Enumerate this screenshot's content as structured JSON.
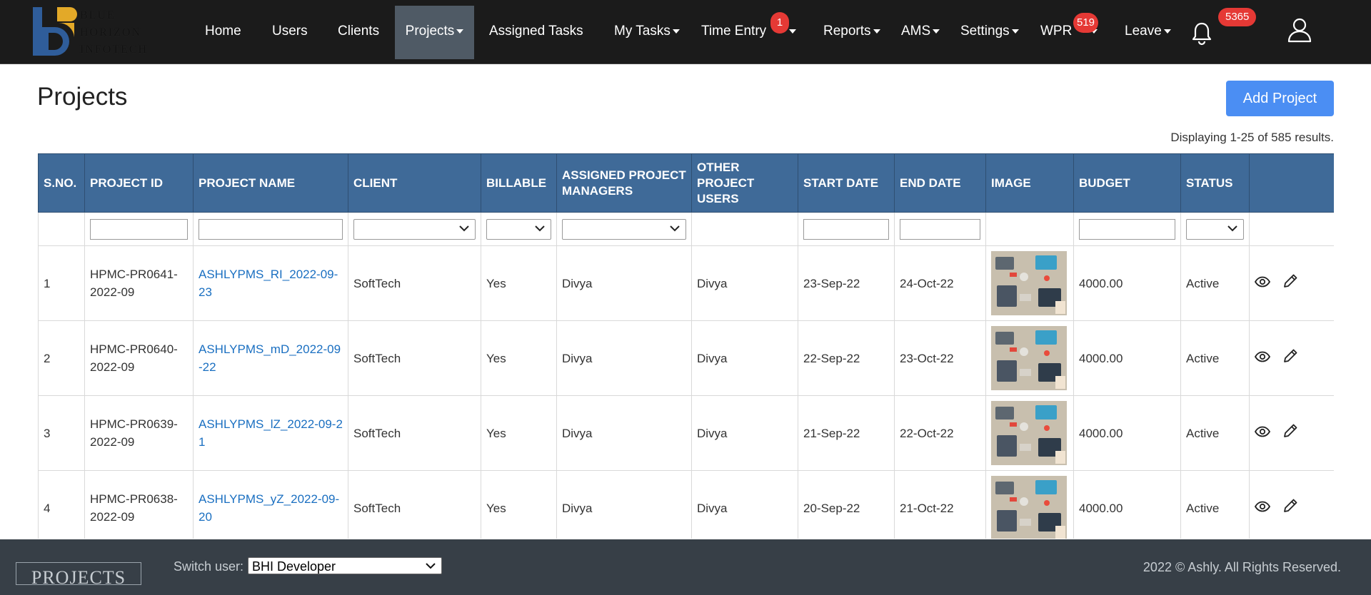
{
  "brand": {
    "name_lines": [
      "BLUE",
      "HORIZON",
      "INFOTECH"
    ]
  },
  "nav": {
    "items": [
      {
        "label": "Home",
        "dropdown": false
      },
      {
        "label": "Users",
        "dropdown": false
      },
      {
        "label": "Clients",
        "dropdown": false
      },
      {
        "label": "Projects",
        "dropdown": true,
        "active": true
      },
      {
        "label": "Assigned Tasks",
        "dropdown": false
      },
      {
        "label": "My Tasks",
        "dropdown": true
      },
      {
        "label": "Time Entry",
        "dropdown": true,
        "badge": "1"
      },
      {
        "label": "Reports",
        "dropdown": true
      },
      {
        "label": "AMS",
        "dropdown": true
      },
      {
        "label": "Settings",
        "dropdown": true
      },
      {
        "label": "WPR",
        "dropdown": true,
        "badge": "519"
      },
      {
        "label": "Leave",
        "dropdown": true
      }
    ],
    "notifications_badge": "5365",
    "icons": [
      "bell-icon",
      "user-icon"
    ]
  },
  "page": {
    "title": "Projects",
    "add_button": "Add Project",
    "summary": "Displaying 1-25 of 585 results."
  },
  "table": {
    "columns": [
      "S.NO.",
      "PROJECT ID",
      "PROJECT NAME",
      "CLIENT",
      "BILLABLE",
      "ASSIGNED PROJECT MANAGERS",
      "OTHER PROJECT USERS",
      "START DATE",
      "END DATE",
      "IMAGE",
      "BUDGET",
      "STATUS",
      ""
    ],
    "rows": [
      {
        "sno": "1",
        "project_id": "HPMC-PR0641-2022-09",
        "name": "ASHLYPMS_RI_2022-09-23",
        "client": "SoftTech",
        "billable": "Yes",
        "managers": "Divya",
        "users": "Divya",
        "start": "23-Sep-22",
        "end": "24-Oct-22",
        "budget": "4000.00",
        "status": "Active"
      },
      {
        "sno": "2",
        "project_id": "HPMC-PR0640-2022-09",
        "name": "ASHLYPMS_mD_2022-09-22",
        "client": "SoftTech",
        "billable": "Yes",
        "managers": "Divya",
        "users": "Divya",
        "start": "22-Sep-22",
        "end": "23-Oct-22",
        "budget": "4000.00",
        "status": "Active"
      },
      {
        "sno": "3",
        "project_id": "HPMC-PR0639-2022-09",
        "name": "ASHLYPMS_lZ_2022-09-21",
        "client": "SoftTech",
        "billable": "Yes",
        "managers": "Divya",
        "users": "Divya",
        "start": "21-Sep-22",
        "end": "22-Oct-22",
        "budget": "4000.00",
        "status": "Active"
      },
      {
        "sno": "4",
        "project_id": "HPMC-PR0638-2022-09",
        "name": "ASHLYPMS_yZ_2022-09-20",
        "client": "SoftTech",
        "billable": "Yes",
        "managers": "Divya",
        "users": "Divya",
        "start": "20-Sep-22",
        "end": "21-Oct-22",
        "budget": "4000.00",
        "status": "Active"
      }
    ],
    "row_icons": [
      "view-eye-icon",
      "edit-pencil-icon"
    ]
  },
  "footer": {
    "logo_text": "PROJECTS",
    "switch_label": "Switch user:",
    "switch_value": "BHI Developer",
    "copyright": "2022 © Ashly. All Rights Reserved."
  },
  "colors": {
    "navbar": "#1b1b1b",
    "active_nav": "#4f5a65",
    "badge": "#e53935",
    "table_header": "#3f6a98",
    "link": "#1a6fc1",
    "primary_button": "#4b8ef3",
    "footer": "#373f47"
  }
}
